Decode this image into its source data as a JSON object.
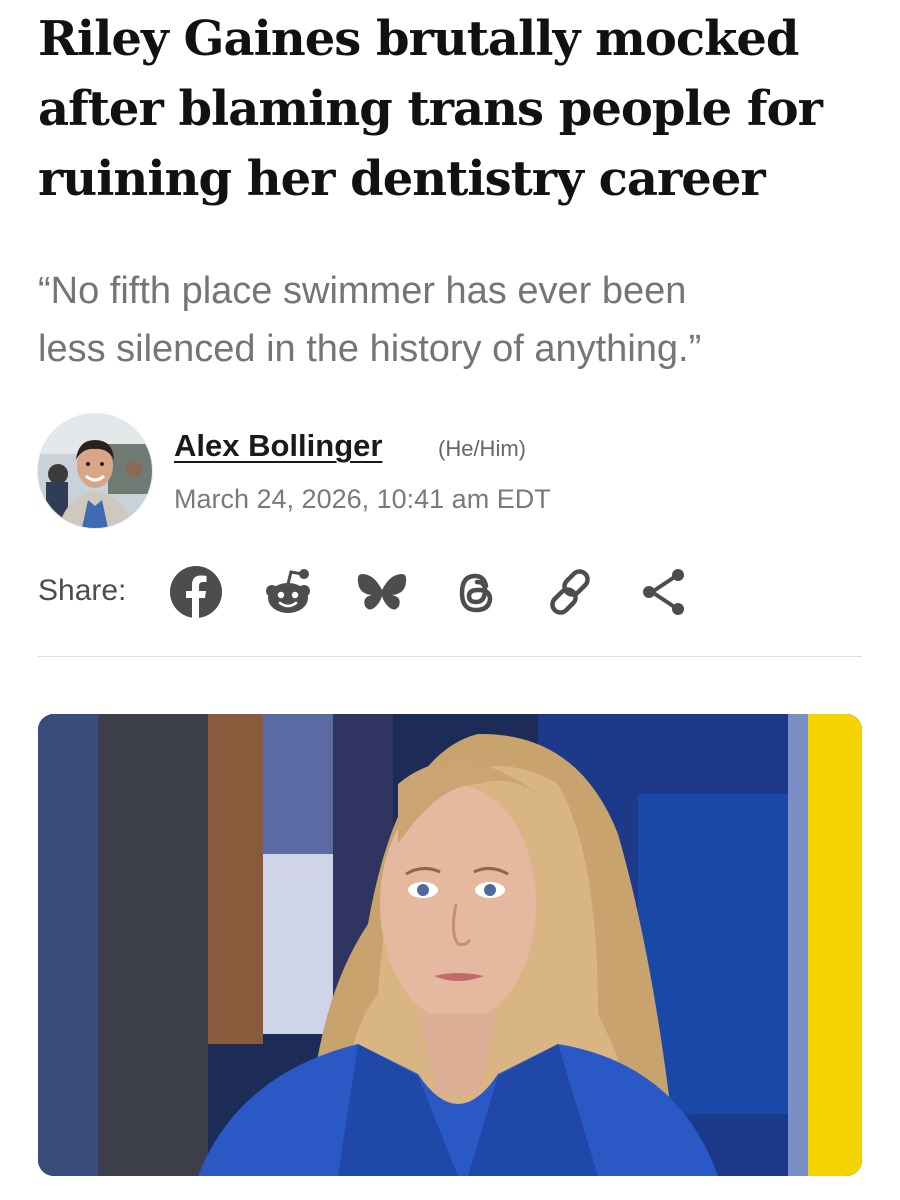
{
  "article": {
    "headline_lines": [
      "Riley Gaines brutally mocked",
      "after blaming trans people for",
      "ruining her dentistry career"
    ],
    "dek_lines": [
      "“No fifth place swimmer has ever been",
      "less silenced in the history of anything.”"
    ]
  },
  "byline": {
    "author": "Alex Bollinger",
    "pronouns": "(He/Him)",
    "date": "March 24, 2026, 10:41 am EDT"
  },
  "share": {
    "label": "Share:",
    "icons": [
      "facebook-icon",
      "reddit-icon",
      "bluesky-icon",
      "threads-icon",
      "link-icon",
      "share-icon"
    ]
  },
  "colors": {
    "text_dark": "#111111",
    "dek_gray": "#757575",
    "icon_gray": "#4d4d4d",
    "hero_blue": "#1d2b57",
    "hero_yellow": "#f4d400"
  }
}
